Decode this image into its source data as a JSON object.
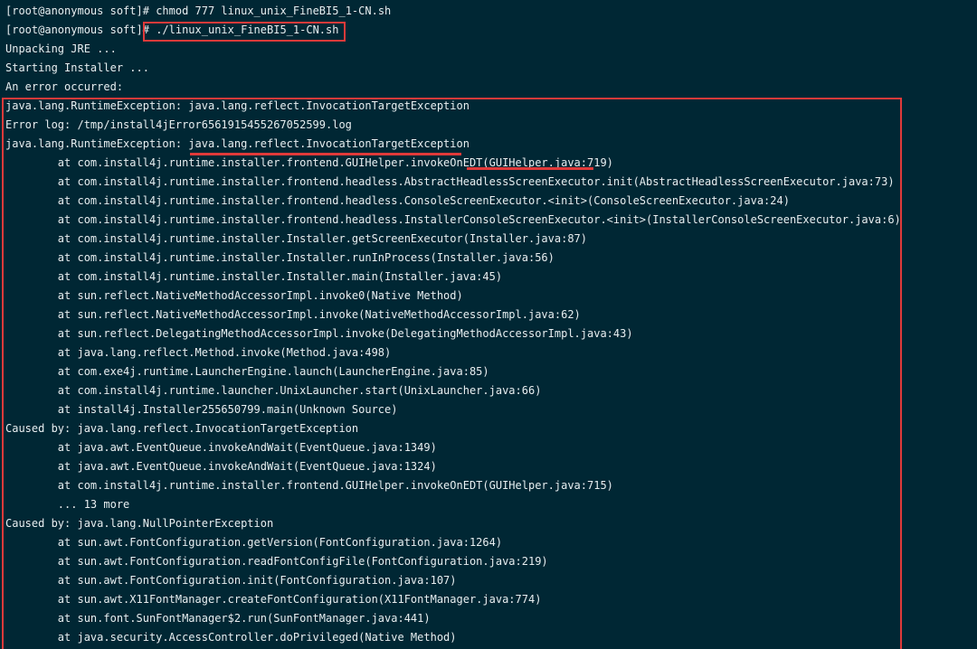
{
  "prompt": "[root@anonymous soft]#",
  "commands": {
    "chmod": "chmod 777 linux_unix_FineBI5_1-CN.sh",
    "run": "./linux_unix_FineBI5_1-CN.sh"
  },
  "output": [
    "Unpacking JRE ...",
    "Starting Installer ...",
    "An error occurred:"
  ],
  "trace": [
    "java.lang.RuntimeException: java.lang.reflect.InvocationTargetException",
    "Error log: /tmp/install4jError6561915455267052599.log",
    "java.lang.RuntimeException: java.lang.reflect.InvocationTargetException",
    "        at com.install4j.runtime.installer.frontend.GUIHelper.invokeOnEDT(GUIHelper.java:719)",
    "        at com.install4j.runtime.installer.frontend.headless.AbstractHeadlessScreenExecutor.init(AbstractHeadlessScreenExecutor.java:73)",
    "        at com.install4j.runtime.installer.frontend.headless.ConsoleScreenExecutor.<init>(ConsoleScreenExecutor.java:24)",
    "        at com.install4j.runtime.installer.frontend.headless.InstallerConsoleScreenExecutor.<init>(InstallerConsoleScreenExecutor.java:6)",
    "        at com.install4j.runtime.installer.Installer.getScreenExecutor(Installer.java:87)",
    "        at com.install4j.runtime.installer.Installer.runInProcess(Installer.java:56)",
    "        at com.install4j.runtime.installer.Installer.main(Installer.java:45)",
    "        at sun.reflect.NativeMethodAccessorImpl.invoke0(Native Method)",
    "        at sun.reflect.NativeMethodAccessorImpl.invoke(NativeMethodAccessorImpl.java:62)",
    "        at sun.reflect.DelegatingMethodAccessorImpl.invoke(DelegatingMethodAccessorImpl.java:43)",
    "        at java.lang.reflect.Method.invoke(Method.java:498)",
    "        at com.exe4j.runtime.LauncherEngine.launch(LauncherEngine.java:85)",
    "        at com.install4j.runtime.launcher.UnixLauncher.start(UnixLauncher.java:66)",
    "        at install4j.Installer255650799.main(Unknown Source)",
    "Caused by: java.lang.reflect.InvocationTargetException",
    "        at java.awt.EventQueue.invokeAndWait(EventQueue.java:1349)",
    "        at java.awt.EventQueue.invokeAndWait(EventQueue.java:1324)",
    "        at com.install4j.runtime.installer.frontend.GUIHelper.invokeOnEDT(GUIHelper.java:715)",
    "        ... 13 more",
    "Caused by: java.lang.NullPointerException",
    "        at sun.awt.FontConfiguration.getVersion(FontConfiguration.java:1264)",
    "        at sun.awt.FontConfiguration.readFontConfigFile(FontConfiguration.java:219)",
    "        at sun.awt.FontConfiguration.init(FontConfiguration.java:107)",
    "        at sun.awt.X11FontManager.createFontConfiguration(X11FontManager.java:774)",
    "        at sun.font.SunFontManager$2.run(SunFontManager.java:441)",
    "        at java.security.AccessController.doPrivileged(Native Method)"
  ],
  "colors": {
    "background": "#002734",
    "text": "#e8eef0",
    "highlight": "#e03a3a"
  }
}
